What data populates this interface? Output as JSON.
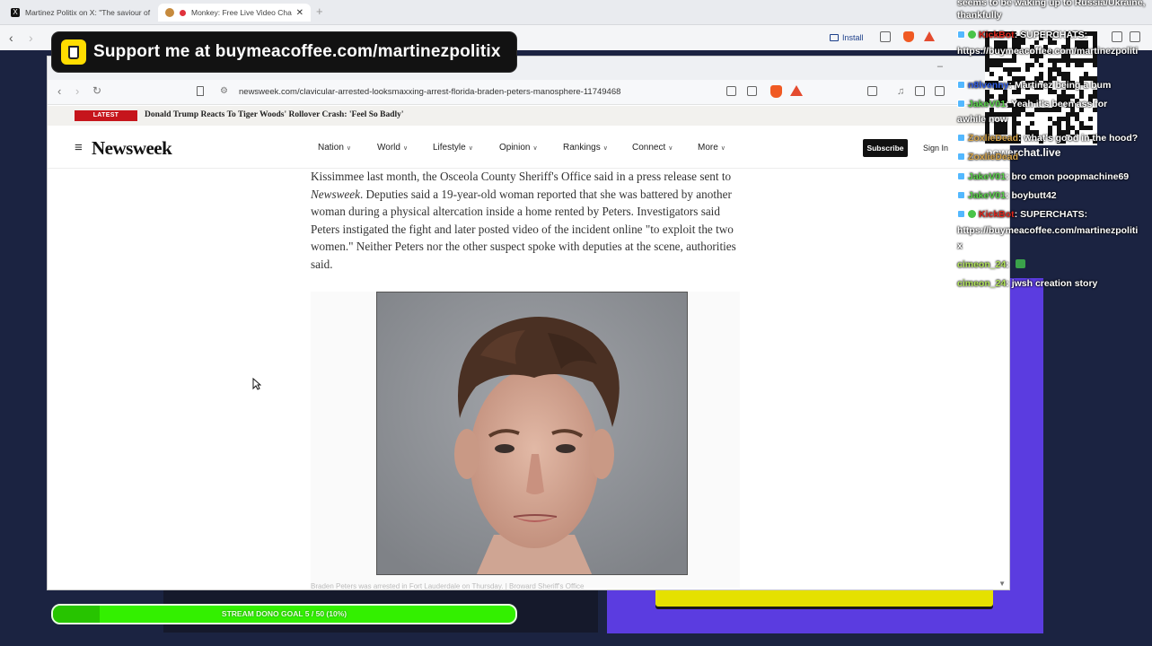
{
  "outer_browser": {
    "tabs": [
      {
        "label": "Martinez Politix on X: \"The saviour of",
        "icon": "x-logo-icon"
      },
      {
        "label": "Monkey: Free Live Video Cha",
        "icon": "monkey-icon",
        "active": true
      }
    ],
    "install_label": "Install"
  },
  "support_banner": {
    "text": "Support me at buymeacoffee.com/martinezpolitix"
  },
  "inner_browser": {
    "url": "newsweek.com/clavicular-arrested-looksmaxxing-arrest-florida-braden-peters-manosphere-11749468"
  },
  "newsweek": {
    "latest_badge": "LATEST",
    "latest_headline": "Donald Trump Reacts To Tiger Woods' Rollover Crash: 'Feel So Badly'",
    "logo": "Newsweek",
    "nav": [
      "Nation",
      "World",
      "Lifestyle",
      "Opinion",
      "Rankings",
      "Connect",
      "More"
    ],
    "subscribe": "Subscribe",
    "sign_in": "Sign In",
    "article_pre": "Kissimmee last month, the Osceola County Sheriff's Office said in a press release sent to ",
    "article_em": "Newsweek",
    "article_post": ". Deputies said a 19-year-old woman reported that she was battered by another woman during a physical altercation inside a home rented by Peters. Investigators said Peters instigated the fight and later posted video of the incident online \"to exploit the two women.\" Neither Peters nor the other suspect spoke with deputies at the scene, authorities said.",
    "caption": "Braden Peters was arrested in Fort Lauderdale on Thursday. | Broward Sheriff's Office"
  },
  "chat": {
    "top_text_1": "seems to be waking up to Russia/Ukraine,",
    "top_text_2": "thankfully",
    "messages": [
      {
        "user": "KickBot",
        "text": ": SUPERCHATS:",
        "color": "red"
      },
      {
        "user": "",
        "text": "https://buymeacoffee.com/martinezpoliti",
        "color": "none"
      },
      {
        "user": "n8lvenny",
        "text": ": Martinez being a bum",
        "color": "blue"
      },
      {
        "user": "JakeV01",
        "text": ": Yeah it's been ass for",
        "color": "green"
      },
      {
        "user": "",
        "text": "awhile now",
        "color": "none"
      },
      {
        "user": "ZoxlieDead",
        "text": ": what's good in the hood?",
        "color": "tan"
      },
      {
        "user": "ZoxlieDead",
        "text": "",
        "color": "tan"
      },
      {
        "user": "JakeV01",
        "text": ": bro cmon poopmachine69",
        "color": "green"
      },
      {
        "user": "JakeV01",
        "text": ": boybutt42",
        "color": "green"
      },
      {
        "user": "KickBot",
        "text": ": SUPERCHATS:",
        "color": "red"
      },
      {
        "user": "",
        "text": "https://buymeacoffee.com/martinezpoliti",
        "color": "none"
      },
      {
        "user": "",
        "text": "x",
        "color": "none"
      },
      {
        "user": "cimeon_24",
        "text": ":",
        "color": "lime"
      },
      {
        "user": "cimeon_24",
        "text": ": jwsh creation story",
        "color": "lime"
      }
    ],
    "qr_label": "powerchat.live"
  },
  "stream_goal": {
    "label": "STREAM DONO GOAL 5 / 50 (10%)",
    "progress": 0.1
  },
  "colors": {
    "goal_green": "#33f000",
    "purple_panel": "#5b3ce0",
    "newsweek_red": "#c6151c",
    "banner_yellow": "#ffdd00"
  }
}
